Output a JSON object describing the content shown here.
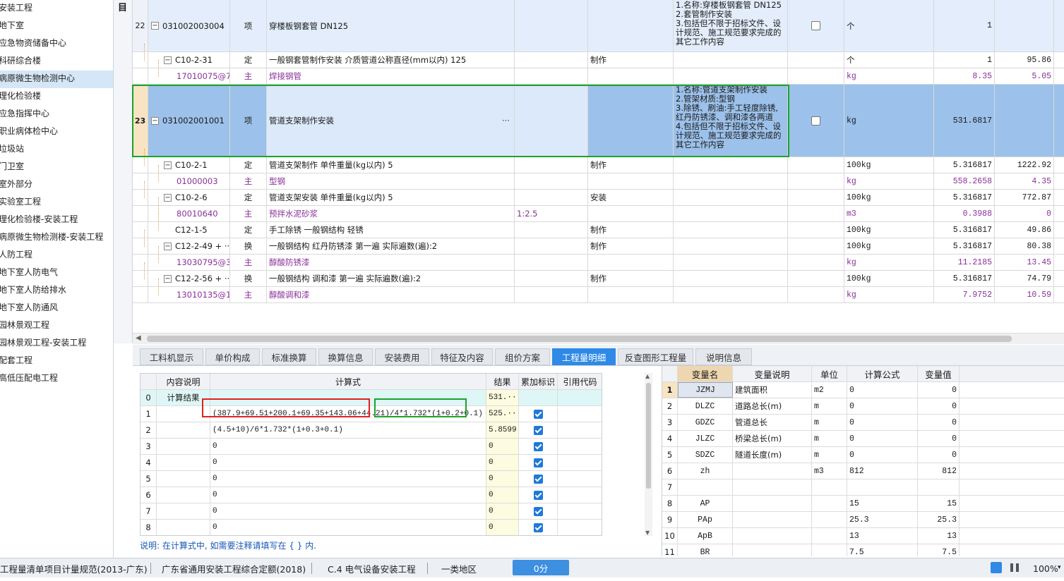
{
  "tree": [
    {
      "label": "安装工程"
    },
    {
      "label": "地下室"
    },
    {
      "label": "应急物资储备中心"
    },
    {
      "label": "科研综合楼"
    },
    {
      "label": "病原微生物检测中心",
      "selected": true
    },
    {
      "label": "理化检验楼"
    },
    {
      "label": "应急指挥中心"
    },
    {
      "label": "职业病体检中心"
    },
    {
      "label": "垃圾站"
    },
    {
      "label": "门卫室"
    },
    {
      "label": "室外部分"
    },
    {
      "label": "实验室工程"
    },
    {
      "label": "理化检验楼-安装工程"
    },
    {
      "label": "病原微生物检测楼-安装工程"
    },
    {
      "label": "人防工程"
    },
    {
      "label": "地下室人防电气"
    },
    {
      "label": "地下室人防给排水"
    },
    {
      "label": "地下室人防通风"
    },
    {
      "label": "园林景观工程"
    },
    {
      "label": "园林景观工程-安装工程"
    },
    {
      "label": "配套工程"
    },
    {
      "label": "高低压配电工程"
    }
  ],
  "gutter_label": "目",
  "rows": [
    {
      "kind": "item",
      "num": "22",
      "code": "031002003004",
      "type": "项",
      "name": "穿楼板钢套管 DN125",
      "feat": "",
      "work": "",
      "desc": "1.名称:穿楼板钢套管 DN125\n2.套管制作安装\n3.包括但不限于招标文件、设计规范、施工规范要求完成的其它工作内容",
      "chk": true,
      "unit": "个",
      "qty": "1",
      "price": ""
    },
    {
      "kind": "quota",
      "num": "",
      "code": "C10-2-31",
      "type": "定",
      "name": "一般钢套管制作安装 介质管道公称直径(mm以内) 125",
      "feat": "",
      "work": "制作",
      "desc": "",
      "unit": "个",
      "qty": "1",
      "price": "95.86"
    },
    {
      "kind": "main",
      "num": "",
      "code": "17010075@7",
      "type": "主",
      "name": "焊接钢管",
      "feat": "",
      "work": "",
      "desc": "",
      "unit": "kg",
      "qty": "8.35",
      "price": "5.05"
    },
    {
      "kind": "item-sel",
      "num": "23",
      "code": "031002001001",
      "type": "项",
      "name": "管道支架制作安装",
      "feat": "",
      "work": "",
      "desc": "1.名称:管道支架制作安装\n2.管架材质:型钢\n3.除锈、刷油:手工轻度除锈,红丹防锈漆、调和漆各两道\n4.包括但不限于招标文件、设计规范、施工规范要求完成的其它工作内容",
      "chk": true,
      "unit": "kg",
      "qty": "531.6817",
      "price": "",
      "more": "···"
    },
    {
      "kind": "quota",
      "num": "",
      "code": "C10-2-1",
      "type": "定",
      "name": "管道支架制作 单件重量(kg以内) 5",
      "feat": "",
      "work": "制作",
      "desc": "",
      "unit": "100kg",
      "qty": "5.316817",
      "price": "1222.92"
    },
    {
      "kind": "main",
      "num": "",
      "code": "01000003",
      "type": "主",
      "name": "型钢",
      "feat": "",
      "work": "",
      "desc": "",
      "unit": "kg",
      "qty": "558.2658",
      "price": "4.35"
    },
    {
      "kind": "quota",
      "num": "",
      "code": "C10-2-6",
      "type": "定",
      "name": "管道支架安装 单件重量(kg以内) 5",
      "feat": "",
      "work": "安装",
      "desc": "",
      "unit": "100kg",
      "qty": "5.316817",
      "price": "772.87"
    },
    {
      "kind": "main",
      "num": "",
      "code": "80010640",
      "type": "主",
      "name": "预拌水泥砂浆",
      "feat": "1:2.5",
      "work": "",
      "desc": "",
      "unit": "m3",
      "qty": "0.3988",
      "price": "0"
    },
    {
      "kind": "quota-nopm",
      "num": "",
      "code": "C12-1-5",
      "type": "定",
      "name": "手工除锈 一般钢结构 轻锈",
      "feat": "",
      "work": "制作",
      "desc": "",
      "unit": "100kg",
      "qty": "5.316817",
      "price": "49.86"
    },
    {
      "kind": "quota",
      "num": "",
      "code": "C12-2-49 + ···",
      "type": "换",
      "name": "一般钢结构 红丹防锈漆 第一遍  实际遍数(遍):2",
      "feat": "",
      "work": "制作",
      "desc": "",
      "unit": "100kg",
      "qty": "5.316817",
      "price": "80.38"
    },
    {
      "kind": "main",
      "num": "",
      "code": "13030795@3",
      "type": "主",
      "name": "醇酸防锈漆",
      "feat": "",
      "work": "",
      "desc": "",
      "unit": "kg",
      "qty": "11.2185",
      "price": "13.45"
    },
    {
      "kind": "quota",
      "num": "",
      "code": "C12-2-56 + ···",
      "type": "换",
      "name": "一般钢结构 调和漆 第一遍  实际遍数(遍):2",
      "feat": "",
      "work": "制作",
      "desc": "",
      "unit": "100kg",
      "qty": "5.316817",
      "price": "74.79"
    },
    {
      "kind": "main",
      "num": "",
      "code": "13010135@1",
      "type": "主",
      "name": "醇酸调和漆",
      "feat": "",
      "work": "",
      "desc": "",
      "unit": "kg",
      "qty": "7.9752",
      "price": "10.59"
    }
  ],
  "tabs": [
    "工料机显示",
    "单价构成",
    "标准换算",
    "换算信息",
    "安装费用",
    "特征及内容",
    "组价方案",
    "工程量明细",
    "反查图形工程量",
    "说明信息"
  ],
  "active_tab": "工程量明细",
  "calc": {
    "headers": [
      "",
      "内容说明",
      "计算式",
      "结果",
      "累加标识",
      "引用代码"
    ],
    "rows": [
      {
        "n": "0",
        "desc": "计算结果",
        "expr": "",
        "result": "531.···",
        "chk": false
      },
      {
        "n": "1",
        "desc": "",
        "expr": "(387.9+69.51+200.1+69.35+143.06+44.21)/4*1.732*(1+0.2+0.1)",
        "result": "525.···",
        "chk": true
      },
      {
        "n": "2",
        "desc": "",
        "expr": "(4.5+10)/6*1.732*(1+0.3+0.1)",
        "result": "5.8599",
        "chk": true
      },
      {
        "n": "3",
        "desc": "",
        "expr": "0",
        "result": "0",
        "chk": true
      },
      {
        "n": "4",
        "desc": "",
        "expr": "0",
        "result": "0",
        "chk": true
      },
      {
        "n": "5",
        "desc": "",
        "expr": "0",
        "result": "0",
        "chk": true
      },
      {
        "n": "6",
        "desc": "",
        "expr": "0",
        "result": "0",
        "chk": true
      },
      {
        "n": "7",
        "desc": "",
        "expr": "0",
        "result": "0",
        "chk": true
      },
      {
        "n": "8",
        "desc": "",
        "expr": "0",
        "result": "0",
        "chk": true
      }
    ],
    "note": "说明: 在计算式中, 如需要注释请填写在 { } 内."
  },
  "vars": {
    "headers": [
      "",
      "变量名",
      "变量说明",
      "单位",
      "计算公式",
      "变量值"
    ],
    "rows": [
      {
        "n": "1",
        "name": "JZMJ",
        "desc": "建筑面积",
        "unit": "m2",
        "formula": "0",
        "value": "0"
      },
      {
        "n": "2",
        "name": "DLZC",
        "desc": "道路总长(m)",
        "unit": "m",
        "formula": "0",
        "value": "0"
      },
      {
        "n": "3",
        "name": "GDZC",
        "desc": "管道总长",
        "unit": "m",
        "formula": "0",
        "value": "0"
      },
      {
        "n": "4",
        "name": "JLZC",
        "desc": "桥梁总长(m)",
        "unit": "m",
        "formula": "0",
        "value": "0"
      },
      {
        "n": "5",
        "name": "SDZC",
        "desc": "隧道长度(m)",
        "unit": "m",
        "formula": "0",
        "value": "0"
      },
      {
        "n": "6",
        "name": "zh",
        "desc": "",
        "unit": "m3",
        "formula": "812",
        "value": "812"
      },
      {
        "n": "7",
        "name": "",
        "desc": "",
        "unit": "",
        "formula": "",
        "value": ""
      },
      {
        "n": "8",
        "name": "AP",
        "desc": "",
        "unit": "",
        "formula": "15",
        "value": "15"
      },
      {
        "n": "9",
        "name": "PAp",
        "desc": "",
        "unit": "",
        "formula": "25.3",
        "value": "25.3"
      },
      {
        "n": "10",
        "name": "ApB",
        "desc": "",
        "unit": "",
        "formula": "13",
        "value": "13"
      },
      {
        "n": "11",
        "name": "BR",
        "desc": "",
        "unit": "",
        "formula": "7.5",
        "value": "7.5"
      }
    ]
  },
  "status": {
    "spec": "工程量清单项目计量规范(2013-广东)",
    "quota": "广东省通用安装工程综合定额(2018)",
    "section": "C.4 电气设备安装工程",
    "region": "一类地区",
    "score": "0分",
    "zoom": "100%"
  },
  "colors": {
    "accent": "#2e8ae6",
    "selected_row": "#9cc1ea",
    "item_row": "#e3edfb",
    "main_text": "#8b2f9a",
    "red_box": "#e02020",
    "green_box": "#1aa32a"
  }
}
